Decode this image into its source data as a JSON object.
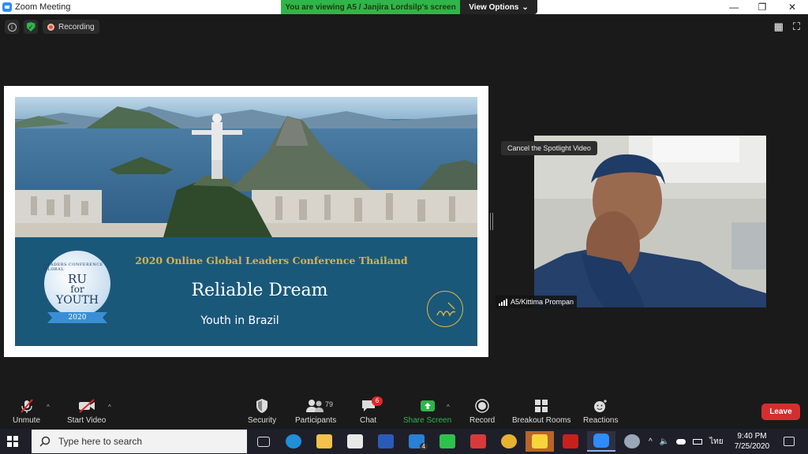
{
  "window": {
    "title": "Zoom Meeting",
    "minimize": "—",
    "restore": "❐",
    "close": "✕"
  },
  "share_banner": {
    "text": "You are viewing A5 / Janjira Lordsilp's screen",
    "view_options": "View Options",
    "chevron": "⌄"
  },
  "status": {
    "info_icon": "i",
    "shield_icon": "✓",
    "recording_label": "Recording"
  },
  "top_right": {
    "gallery_icon": "▦",
    "fullscreen_icon": "⛶"
  },
  "slide": {
    "conference": "2020 Online Global Leaders Conference Thailand",
    "title": "Reliable Dream",
    "subtitle": "Youth in Brazil",
    "badge": {
      "top": "LEADERS CONFERENCE · GLOBAL",
      "line1": "RU",
      "line2": "for",
      "line3": "YOUTH",
      "year": "2020"
    }
  },
  "spotlight": {
    "button": "Cancel the Spotlight Video",
    "participant_name": "A5/Kittima Prompan"
  },
  "toolbar": {
    "unmute": "Unmute",
    "start_video": "Start Video",
    "security": "Security",
    "participants": "Participants",
    "participants_count": "79",
    "chat": "Chat",
    "chat_badge": "6",
    "share_screen": "Share Screen",
    "record": "Record",
    "breakout": "Breakout Rooms",
    "reactions": "Reactions",
    "leave": "Leave",
    "caret": "^"
  },
  "taskbar": {
    "search_placeholder": "Type here to search",
    "mail_badge": "4",
    "lang": "ไทย",
    "time": "9:40 PM",
    "date": "7/25/2020",
    "tray_caret": "^"
  },
  "colors": {
    "share_green": "#2fb54a",
    "leave_red": "#d32f2f",
    "slide_blue": "#1a5879",
    "gold": "#d9b24a",
    "zoom_blue": "#2d8cff"
  }
}
